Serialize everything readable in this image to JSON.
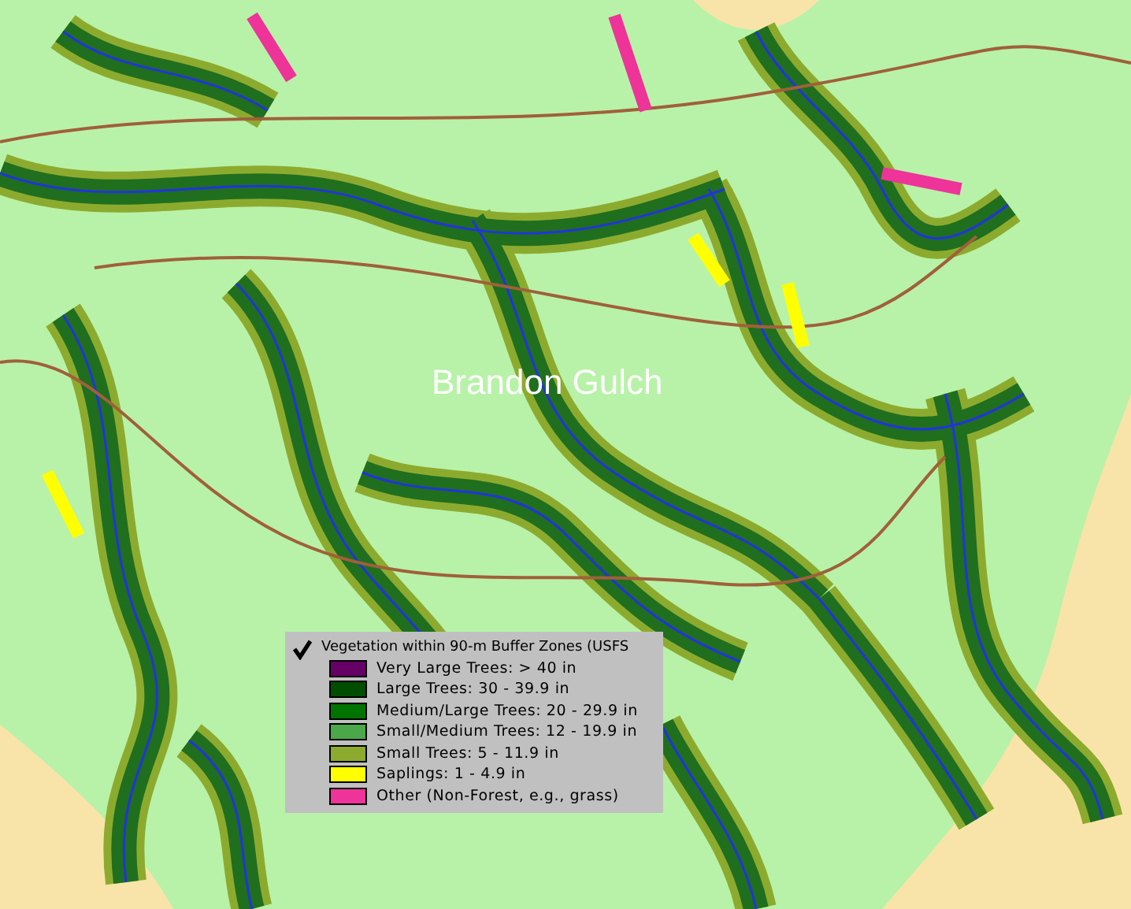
{
  "map": {
    "place_label": "Brandon Gulch"
  },
  "legend": {
    "title": "Vegetation within 90-m Buffer Zones (USFS",
    "checked": true,
    "items": [
      {
        "label": "Very Large Trees: > 40  in",
        "color": "#660066"
      },
      {
        "label": "Large Trees: 30 - 39.9 in",
        "color": "#004d00"
      },
      {
        "label": "Medium/Large Trees: 20 - 29.9 in",
        "color": "#007300"
      },
      {
        "label": "Small/Medium Trees: 12 - 19.9 in",
        "color": "#4aa84a"
      },
      {
        "label": "Small Trees: 5 - 11.9 in",
        "color": "#8cab2e"
      },
      {
        "label": "Saplings: 1 - 4.9 in",
        "color": "#ffff00"
      },
      {
        "label": "Other (Non-Forest, e.g., grass)",
        "color": "#ee3399"
      }
    ]
  }
}
